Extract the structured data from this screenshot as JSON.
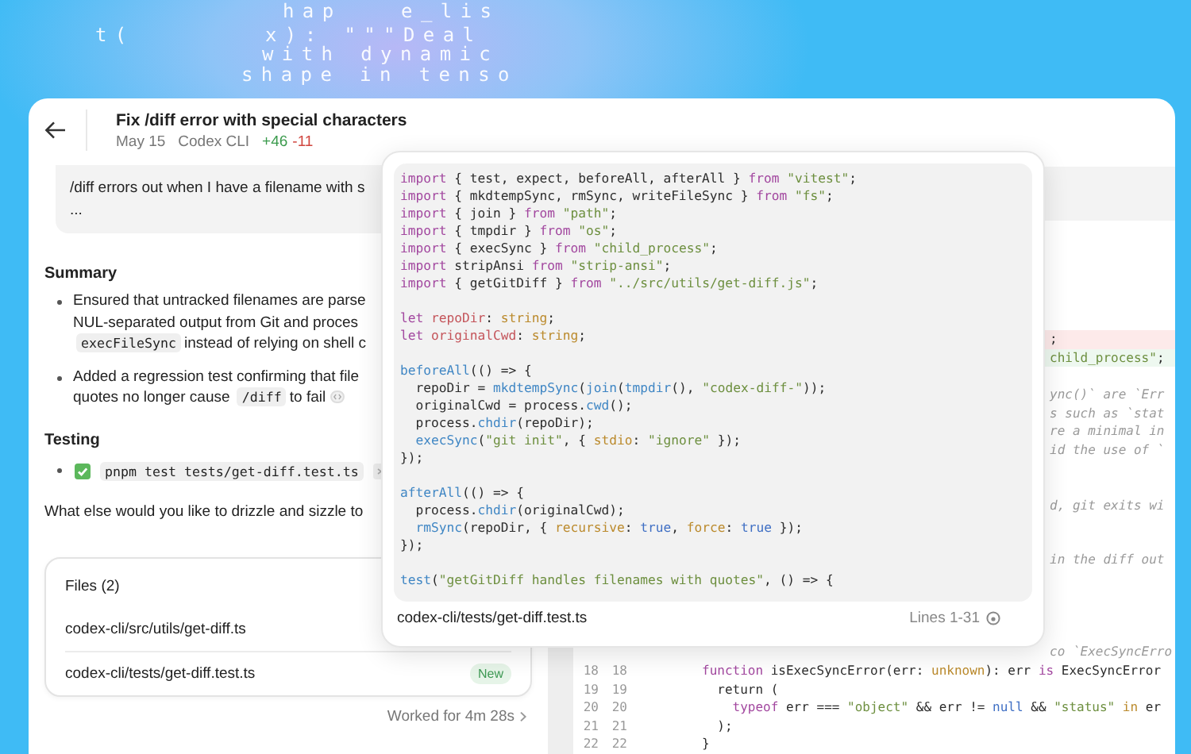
{
  "background_text": [
    "hap   e_lis",
    "t(",
    "x): \"\"\"Deal",
    "with dynamic",
    "shape in tenso"
  ],
  "task": {
    "title": "Fix /diff error with special characters",
    "date": "May 15",
    "source": "Codex CLI",
    "additions": "+46",
    "deletions": "-11"
  },
  "message": {
    "lines": [
      "/diff errors out when I have a filename with s",
      "..."
    ]
  },
  "summary": {
    "heading": "Summary",
    "bullets": [
      {
        "cited": false,
        "lines": [
          [
            {
              "kind": "text",
              "text": "Ensured that untracked filenames are parse"
            }
          ],
          [
            {
              "kind": "text",
              "text": "NUL-separated output from Git and proces"
            }
          ],
          [
            {
              "kind": "code",
              "text": "execFileSync"
            },
            {
              "kind": "text",
              "text": "instead of relying on shell c"
            }
          ]
        ]
      },
      {
        "cited": true,
        "lines": [
          [
            {
              "kind": "text",
              "text": "Added a regression test confirming that file"
            }
          ],
          [
            {
              "kind": "text",
              "text": "quotes no longer cause"
            },
            {
              "kind": "code",
              "text": "/diff"
            },
            {
              "kind": "text",
              "text": "to fail"
            }
          ]
        ]
      }
    ]
  },
  "testing": {
    "heading": "Testing",
    "items": [
      {
        "passed": true,
        "command": "pnpm test tests/get-diff.test.ts",
        "has_log": true
      }
    ]
  },
  "question": "What else would you like to drizzle and sizzle to",
  "files": {
    "heading": "Files (2)",
    "items": [
      {
        "path": "codex-cli/src/utils/get-diff.ts"
      },
      {
        "path": "codex-cli/tests/get-diff.test.ts",
        "badge": "New"
      }
    ]
  },
  "worked": "Worked for 4m 28s",
  "diff_rows": [
    {
      "kind": "del",
      "tokens": [
        {
          "kind": "p",
          "text": ";"
        }
      ]
    },
    {
      "kind": "add",
      "tokens": [
        {
          "kind": "str",
          "text": "child_process\""
        },
        {
          "kind": "p",
          "text": ";"
        }
      ]
    },
    {
      "kind": "blank"
    },
    {
      "kind": "frag",
      "tokens": [
        {
          "kind": "cm",
          "text": "ync()` are `Err"
        }
      ]
    },
    {
      "kind": "frag",
      "tokens": [
        {
          "kind": "cm",
          "text": "s such as `stat"
        }
      ]
    },
    {
      "kind": "frag",
      "tokens": [
        {
          "kind": "cm",
          "text": "re a minimal in"
        }
      ]
    },
    {
      "kind": "frag",
      "tokens": [
        {
          "kind": "cm",
          "text": "id the use of `"
        }
      ]
    },
    {
      "kind": "blank"
    },
    {
      "kind": "blank"
    },
    {
      "kind": "frag",
      "tokens": [
        {
          "kind": "cm",
          "text": "d, git exits wi"
        }
      ]
    },
    {
      "kind": "blank"
    },
    {
      "kind": "blank"
    },
    {
      "kind": "frag",
      "tokens": [
        {
          "kind": "cm",
          "text": "in the diff out"
        }
      ]
    },
    {
      "kind": "blank"
    },
    {
      "kind": "blank"
    },
    {
      "kind": "blank"
    },
    {
      "kind": "blank"
    },
    {
      "kind": "frag",
      "tokens": [
        {
          "kind": "cm",
          "text": "co `ExecSyncErro"
        }
      ]
    },
    {
      "kind": "line",
      "old": "18",
      "new": "18",
      "tokens": [
        {
          "kind": "kw",
          "text": "function"
        },
        {
          "kind": "p",
          "text": " isExecSyncError(err: "
        },
        {
          "kind": "type",
          "text": "unknown"
        },
        {
          "kind": "p",
          "text": "): err "
        },
        {
          "kind": "kw",
          "text": "is"
        },
        {
          "kind": "p",
          "text": " ExecSyncError"
        }
      ]
    },
    {
      "kind": "line",
      "old": "19",
      "new": "19",
      "tokens": [
        {
          "kind": "p",
          "text": "  return ("
        }
      ]
    },
    {
      "kind": "line",
      "old": "20",
      "new": "20",
      "tokens": [
        {
          "kind": "kw",
          "text": "    typeof"
        },
        {
          "kind": "p",
          "text": " err === "
        },
        {
          "kind": "str",
          "text": "\"object\""
        },
        {
          "kind": "p",
          "text": " && err != "
        },
        {
          "kind": "num",
          "text": "null"
        },
        {
          "kind": "p",
          "text": " && "
        },
        {
          "kind": "str",
          "text": "\"status\""
        },
        {
          "kind": "type",
          "text": " in"
        },
        {
          "kind": "p",
          "text": " er"
        }
      ]
    },
    {
      "kind": "line",
      "old": "21",
      "new": "21",
      "tokens": [
        {
          "kind": "p",
          "text": "  );"
        }
      ]
    },
    {
      "kind": "line",
      "old": "22",
      "new": "22",
      "tokens": [
        {
          "kind": "p",
          "text": "}"
        }
      ]
    }
  ],
  "popover": {
    "file": "codex-cli/tests/get-diff.test.ts",
    "range": "Lines 1-31",
    "lines": [
      {
        "kind": "code",
        "tokens": [
          {
            "kind": "kw",
            "text": "import"
          },
          {
            "kind": "p",
            "text": " { test, expect, beforeAll, afterAll } "
          },
          {
            "kind": "kw",
            "text": "from"
          },
          {
            "kind": "str",
            "text": " \"vitest\""
          },
          {
            "kind": "p",
            "text": ";"
          }
        ]
      },
      {
        "kind": "code",
        "tokens": [
          {
            "kind": "kw",
            "text": "import"
          },
          {
            "kind": "p",
            "text": " { mkdtempSync, rmSync, writeFileSync } "
          },
          {
            "kind": "kw",
            "text": "from"
          },
          {
            "kind": "str",
            "text": " \"fs\""
          },
          {
            "kind": "p",
            "text": ";"
          }
        ]
      },
      {
        "kind": "code",
        "tokens": [
          {
            "kind": "kw",
            "text": "import"
          },
          {
            "kind": "p",
            "text": " { join } "
          },
          {
            "kind": "kw",
            "text": "from"
          },
          {
            "kind": "str",
            "text": " \"path\""
          },
          {
            "kind": "p",
            "text": ";"
          }
        ]
      },
      {
        "kind": "code",
        "tokens": [
          {
            "kind": "kw",
            "text": "import"
          },
          {
            "kind": "p",
            "text": " { tmpdir } "
          },
          {
            "kind": "kw",
            "text": "from"
          },
          {
            "kind": "str",
            "text": " \"os\""
          },
          {
            "kind": "p",
            "text": ";"
          }
        ]
      },
      {
        "kind": "code",
        "tokens": [
          {
            "kind": "kw",
            "text": "import"
          },
          {
            "kind": "p",
            "text": " { execSync } "
          },
          {
            "kind": "kw",
            "text": "from"
          },
          {
            "kind": "str",
            "text": " \"child_process\""
          },
          {
            "kind": "p",
            "text": ";"
          }
        ]
      },
      {
        "kind": "code",
        "tokens": [
          {
            "kind": "kw",
            "text": "import"
          },
          {
            "kind": "p",
            "text": " stripAnsi "
          },
          {
            "kind": "kw",
            "text": "from"
          },
          {
            "kind": "str",
            "text": " \"strip-ansi\""
          },
          {
            "kind": "p",
            "text": ";"
          }
        ]
      },
      {
        "kind": "code",
        "tokens": [
          {
            "kind": "kw",
            "text": "import"
          },
          {
            "kind": "p",
            "text": " { getGitDiff } "
          },
          {
            "kind": "kw",
            "text": "from"
          },
          {
            "kind": "str",
            "text": " \"../src/utils/get-diff.js\""
          },
          {
            "kind": "p",
            "text": ";"
          }
        ]
      },
      {
        "kind": "blank"
      },
      {
        "kind": "code",
        "tokens": [
          {
            "kind": "kw",
            "text": "let"
          },
          {
            "kind": "var",
            "text": " repoDir"
          },
          {
            "kind": "p",
            "text": ": "
          },
          {
            "kind": "type",
            "text": "string"
          },
          {
            "kind": "p",
            "text": ";"
          }
        ]
      },
      {
        "kind": "code",
        "tokens": [
          {
            "kind": "kw",
            "text": "let"
          },
          {
            "kind": "var",
            "text": " originalCwd"
          },
          {
            "kind": "p",
            "text": ": "
          },
          {
            "kind": "type",
            "text": "string"
          },
          {
            "kind": "p",
            "text": ";"
          }
        ]
      },
      {
        "kind": "blank"
      },
      {
        "kind": "code",
        "tokens": [
          {
            "kind": "fn",
            "text": "beforeAll"
          },
          {
            "kind": "p",
            "text": "(() => {"
          }
        ]
      },
      {
        "kind": "code",
        "tokens": [
          {
            "kind": "p",
            "text": "  repoDir = "
          },
          {
            "kind": "fn",
            "text": "mkdtempSync"
          },
          {
            "kind": "p",
            "text": "("
          },
          {
            "kind": "fn",
            "text": "join"
          },
          {
            "kind": "p",
            "text": "("
          },
          {
            "kind": "fn",
            "text": "tmpdir"
          },
          {
            "kind": "p",
            "text": "(), "
          },
          {
            "kind": "str",
            "text": "\"codex-diff-\""
          },
          {
            "kind": "p",
            "text": "));"
          }
        ]
      },
      {
        "kind": "code",
        "tokens": [
          {
            "kind": "p",
            "text": "  originalCwd = process."
          },
          {
            "kind": "fn",
            "text": "cwd"
          },
          {
            "kind": "p",
            "text": "();"
          }
        ]
      },
      {
        "kind": "code",
        "tokens": [
          {
            "kind": "p",
            "text": "  process."
          },
          {
            "kind": "fn",
            "text": "chdir"
          },
          {
            "kind": "p",
            "text": "(repoDir);"
          }
        ]
      },
      {
        "kind": "code",
        "tokens": [
          {
            "kind": "fn",
            "text": "  execSync"
          },
          {
            "kind": "p",
            "text": "("
          },
          {
            "kind": "str",
            "text": "\"git init\""
          },
          {
            "kind": "p",
            "text": ", { "
          },
          {
            "kind": "type",
            "text": "stdio"
          },
          {
            "kind": "p",
            "text": ": "
          },
          {
            "kind": "str",
            "text": "\"ignore\""
          },
          {
            "kind": "p",
            "text": " });"
          }
        ]
      },
      {
        "kind": "code",
        "tokens": [
          {
            "kind": "p",
            "text": "});"
          }
        ]
      },
      {
        "kind": "blank"
      },
      {
        "kind": "code",
        "tokens": [
          {
            "kind": "fn",
            "text": "afterAll"
          },
          {
            "kind": "p",
            "text": "(() => {"
          }
        ]
      },
      {
        "kind": "code",
        "tokens": [
          {
            "kind": "p",
            "text": "  process."
          },
          {
            "kind": "fn",
            "text": "chdir"
          },
          {
            "kind": "p",
            "text": "(originalCwd);"
          }
        ]
      },
      {
        "kind": "code",
        "tokens": [
          {
            "kind": "fn",
            "text": "  rmSync"
          },
          {
            "kind": "p",
            "text": "(repoDir, { "
          },
          {
            "kind": "type",
            "text": "recursive"
          },
          {
            "kind": "p",
            "text": ": "
          },
          {
            "kind": "num",
            "text": "true"
          },
          {
            "kind": "p",
            "text": ", "
          },
          {
            "kind": "type",
            "text": "force"
          },
          {
            "kind": "p",
            "text": ": "
          },
          {
            "kind": "num",
            "text": "true"
          },
          {
            "kind": "p",
            "text": " });"
          }
        ]
      },
      {
        "kind": "code",
        "tokens": [
          {
            "kind": "p",
            "text": "});"
          }
        ]
      },
      {
        "kind": "blank"
      },
      {
        "kind": "code",
        "tokens": [
          {
            "kind": "fn",
            "text": "test"
          },
          {
            "kind": "p",
            "text": "("
          },
          {
            "kind": "str",
            "text": "\"getGitDiff handles filenames with quotes\""
          },
          {
            "kind": "p",
            "text": ", () => {"
          }
        ]
      }
    ]
  }
}
